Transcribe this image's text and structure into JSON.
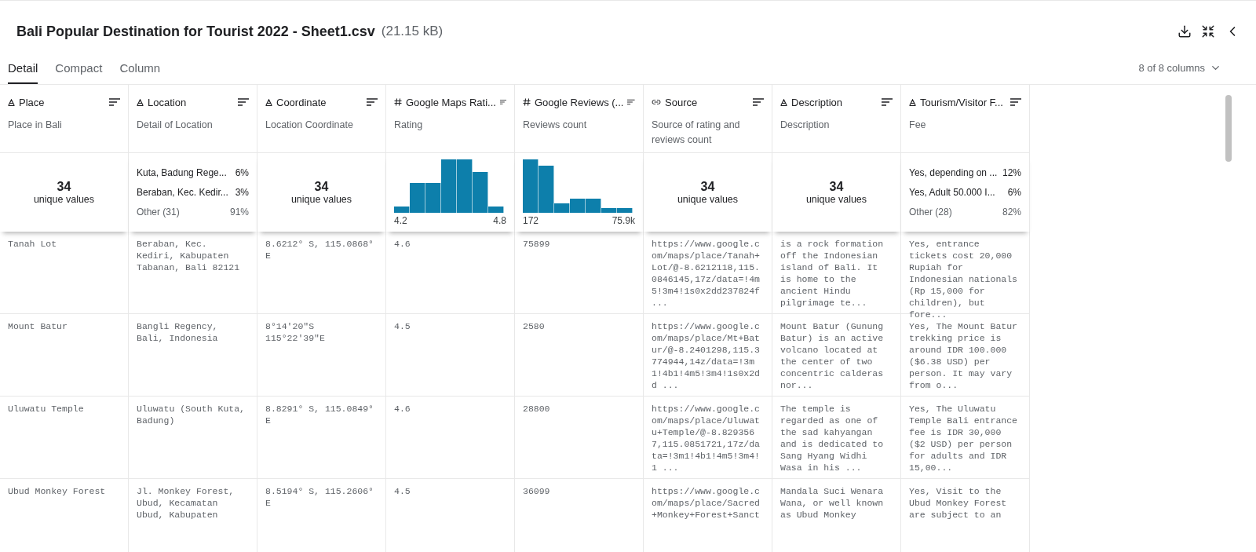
{
  "header": {
    "title": "Bali Popular Destination for Tourist 2022 - Sheet1.csv",
    "size": "(21.15 kB)"
  },
  "tabs": [
    {
      "label": "Detail",
      "selected": true
    },
    {
      "label": "Compact",
      "selected": false
    },
    {
      "label": "Column",
      "selected": false
    }
  ],
  "column_count": "8 of 8 columns",
  "table": {
    "columns": [
      {
        "kind": "text",
        "name": "Place",
        "description": "Place in Bali",
        "summary": {
          "kind": "unique",
          "count": "34",
          "label": "unique values"
        }
      },
      {
        "kind": "text",
        "name": "Location",
        "description": "Detail of Location",
        "summary": {
          "kind": "top",
          "items": [
            {
              "label": "Kuta, Badung Rege...",
              "share": "6%",
              "other": false
            },
            {
              "label": "Beraban, Kec. Kedir...",
              "share": "3%",
              "other": false
            },
            {
              "label": "Other (31)",
              "share": "91%",
              "other": true
            }
          ]
        }
      },
      {
        "kind": "text",
        "name": "Coordinate",
        "description": "Location Coordinate",
        "summary": {
          "kind": "unique",
          "count": "34",
          "label": "unique values"
        }
      },
      {
        "kind": "number",
        "name": "Google Maps Rati...",
        "description": "Rating",
        "summary": {
          "kind": "histogram",
          "min": "4.2",
          "max": "4.8"
        }
      },
      {
        "kind": "number",
        "name": "Google Reviews (...",
        "description": "Reviews count",
        "summary": {
          "kind": "histogram",
          "min": "172",
          "max": "75.9k"
        }
      },
      {
        "kind": "link",
        "name": "Source",
        "description": "Source of rating and reviews count",
        "summary": {
          "kind": "unique",
          "count": "34",
          "label": "unique values"
        }
      },
      {
        "kind": "text",
        "name": "Description",
        "description": "Description",
        "summary": {
          "kind": "unique",
          "count": "34",
          "label": "unique values"
        }
      },
      {
        "kind": "text",
        "name": "Tourism/Visitor F...",
        "description": "Fee",
        "summary": {
          "kind": "top",
          "items": [
            {
              "label": "Yes, depending on ...",
              "share": "12%",
              "other": false
            },
            {
              "label": "Yes, Adult 50.000 I...",
              "share": "6%",
              "other": false
            },
            {
              "label": "Other (28)",
              "share": "82%",
              "other": true
            }
          ]
        }
      }
    ],
    "rows": [
      [
        "Tanah Lot",
        "Beraban, Kec. Kediri, Kabupaten Tabanan, Bali 82121",
        "8.6212° S, 115.0868° E",
        "4.6",
        "75899",
        "https://www.google.com/maps/place/Tanah+Lot/@-8.6212118,115.0846145,17z/data=!4m5!3m4!1s0x2dd237824f ...",
        "is a rock formation off the Indonesian island of Bali. It is home to the ancient Hindu pilgrimage te...",
        "Yes, entrance tickets cost 20,000 Rupiah for Indonesian nationals (Rp 15,000 for children), but fore..."
      ],
      [
        "Mount Batur",
        "Bangli Regency, Bali, Indonesia",
        "8°14'20\"S 115°22'39\"E",
        "4.5",
        "2580",
        "https://www.google.com/maps/place/Mt+Batur/@-8.2401298,115.3774944,14z/data=!3m1!4b1!4m5!3m4!1s0x2dd ...",
        "Mount Batur (Gunung Batur) is an active volcano located at the center of two concentric calderas nor...",
        "Yes, The Mount Batur trekking price is around IDR 100.000 ($6.38 USD) per person. It may vary from o..."
      ],
      [
        "Uluwatu Temple",
        "Uluwatu (South Kuta, Badung)",
        "8.8291° S, 115.0849° E",
        "4.6",
        "28800",
        "https://www.google.com/maps/place/Uluwatu+Temple/@-8.8293567,115.0851721,17z/data=!3m1!4b1!4m5!3m4!1 ...",
        "The temple is regarded as one of the sad kahyangan and is dedicated to Sang Hyang Widhi Wasa in his ...",
        "Yes, The Uluwatu Temple Bali entrance fee is IDR 30,000 ($2 USD) per person for adults and IDR 15,00..."
      ],
      [
        "Ubud Monkey Forest",
        "Jl. Monkey Forest, Ubud, Kecamatan Ubud, Kabupaten",
        "8.5194° S, 115.2606° E",
        "4.5",
        "36099",
        "https://www.google.com/maps/place/Sacred+Monkey+Forest+Sanct",
        "Mandala Suci Wenara Wana, or well known as Ubud Monkey",
        "Yes, Visit to the Ubud Monkey Forest are subject to an"
      ]
    ]
  }
}
